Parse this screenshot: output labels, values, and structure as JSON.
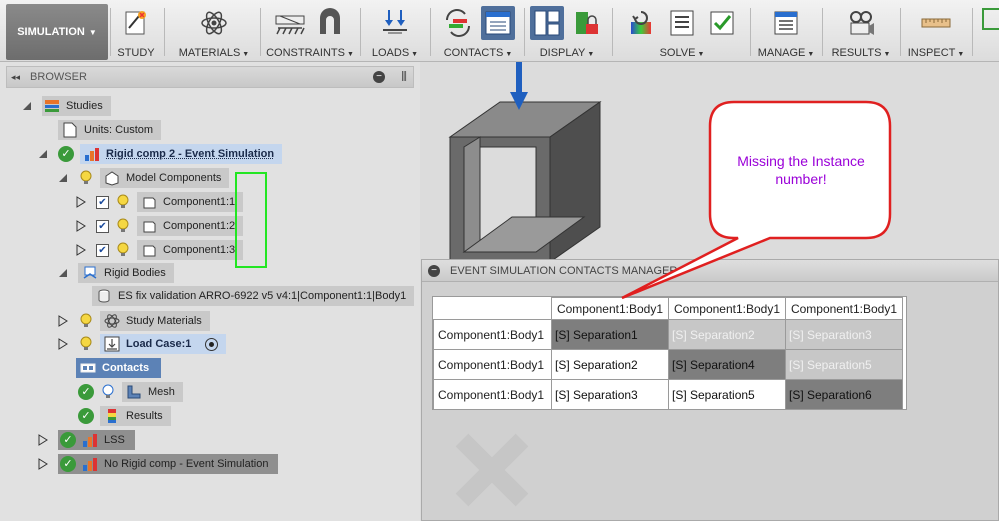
{
  "toolbar": {
    "workspace": "SIMULATION",
    "groups": [
      {
        "label": "STUDY",
        "dropdown": false
      },
      {
        "label": "MATERIALS",
        "dropdown": true
      },
      {
        "label": "CONSTRAINTS",
        "dropdown": true
      },
      {
        "label": "LOADS",
        "dropdown": true
      },
      {
        "label": "CONTACTS",
        "dropdown": true
      },
      {
        "label": "DISPLAY",
        "dropdown": true
      },
      {
        "label": "SOLVE",
        "dropdown": true
      },
      {
        "label": "MANAGE",
        "dropdown": true
      },
      {
        "label": "RESULTS",
        "dropdown": true
      },
      {
        "label": "INSPECT",
        "dropdown": true
      }
    ]
  },
  "browser": {
    "title": "BROWSER",
    "nodes": {
      "studies": "Studies",
      "units": "Units: Custom",
      "study": "Rigid comp 2 - Event Simulation",
      "model_components": "Model Components",
      "component1": "Component1:1",
      "component2": "Component1:2",
      "component3": "Component1:3",
      "rigid_bodies": "Rigid Bodies",
      "rigid_body_item": "ES fix validation ARRO-6922 v5 v4:1|Component1:1|Body1",
      "study_materials": "Study Materials",
      "load_case": "Load Case:1",
      "contacts": "Contacts",
      "mesh": "Mesh",
      "results": "Results",
      "lss": "LSS",
      "no_rigid": "No Rigid comp  - Event Simulation"
    }
  },
  "contacts_manager": {
    "title": "EVENT SIMULATION CONTACTS MANAGER",
    "columns": [
      "Component1:Body1",
      "Component1:Body1",
      "Component1:Body1"
    ],
    "rows": [
      {
        "label": "Component1:Body1",
        "cells": [
          "[S] Separation1",
          "[S] Separation2",
          "[S] Separation3"
        ]
      },
      {
        "label": "Component1:Body1",
        "cells": [
          "[S] Separation2",
          "[S] Separation4",
          "[S] Separation5"
        ]
      },
      {
        "label": "Component1:Body1",
        "cells": [
          "[S] Separation3",
          "[S] Separation5",
          "[S] Separation6"
        ]
      }
    ]
  },
  "callout": {
    "text_line1": "Missing the Instance",
    "text_line2": "number!",
    "text_color": "#9a00d8",
    "border_color": "#e02020"
  },
  "colors": {
    "active_tool": "#4f6f9b",
    "highlight_box": "#22e622",
    "contacts_chip": "#5c82b6"
  }
}
